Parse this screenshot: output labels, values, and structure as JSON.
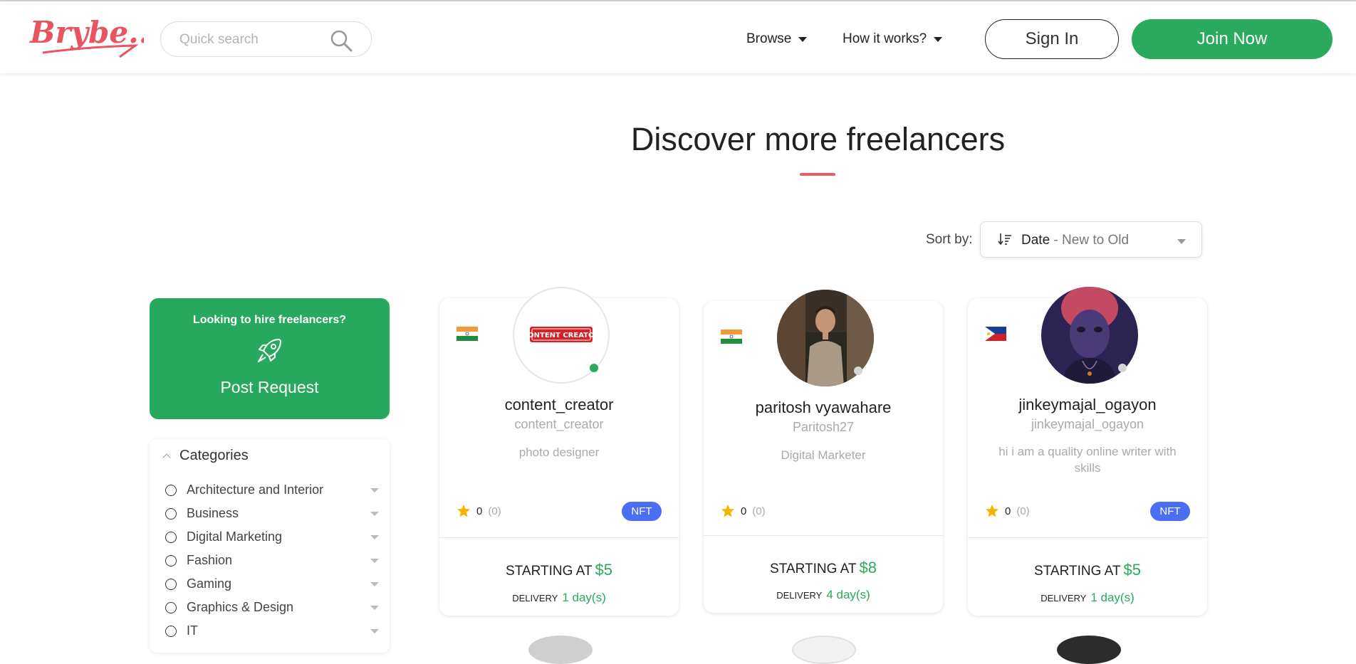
{
  "header": {
    "logo_text": "Brybe...",
    "search_placeholder": "Quick search",
    "nav": [
      {
        "label": "Browse"
      },
      {
        "label": "How it works?"
      }
    ],
    "signin_label": "Sign In",
    "join_label": "Join Now"
  },
  "main": {
    "title": "Discover more freelancers",
    "sort": {
      "label": "Sort by:",
      "value_main": "Date",
      "value_sub": "- New to Old"
    }
  },
  "sidebar": {
    "post": {
      "prompt": "Looking to hire freelancers?",
      "button": "Post Request"
    },
    "categories": {
      "title": "Categories",
      "items": [
        {
          "label": "Architecture and Interior"
        },
        {
          "label": "Business"
        },
        {
          "label": "Digital Marketing"
        },
        {
          "label": "Fashion"
        },
        {
          "label": "Gaming"
        },
        {
          "label": "Graphics & Design"
        },
        {
          "label": "IT"
        }
      ]
    }
  },
  "freelancers": [
    {
      "name": "content_creator",
      "handle": "content_creator",
      "bio": "photo designer",
      "country_flag": "india-flag-icon",
      "avatar_text": "CONTENT CREATOR",
      "rating": "0",
      "rating_count": "(0)",
      "badge": "NFT",
      "starting_label": "STARTING AT",
      "price": "$5",
      "delivery_label": "DELIVERY",
      "delivery": "1 day(s)",
      "online": true
    },
    {
      "name": "paritosh vyawahare",
      "handle": "Paritosh27",
      "bio": "Digital Marketer",
      "country_flag": "india-flag-icon",
      "avatar_text": "",
      "rating": "0",
      "rating_count": "(0)",
      "badge": "",
      "starting_label": "STARTING AT",
      "price": "$8",
      "delivery_label": "DELIVERY",
      "delivery": "4 day(s)",
      "online": false
    },
    {
      "name": "jinkeymajal_ogayon",
      "handle": "jinkeymajal_ogayon",
      "bio": "hi i am a quality online writer with skills",
      "country_flag": "philippines-flag-icon",
      "avatar_text": "",
      "rating": "0",
      "rating_count": "(0)",
      "badge": "NFT",
      "starting_label": "STARTING AT",
      "price": "$5",
      "delivery_label": "DELIVERY",
      "delivery": "1 day(s)",
      "online": false
    }
  ],
  "colors": {
    "brand_red": "#e8545f",
    "accent_green": "#2aaa5c",
    "nft_blue": "#4c6ef5",
    "star": "#f5b400"
  }
}
